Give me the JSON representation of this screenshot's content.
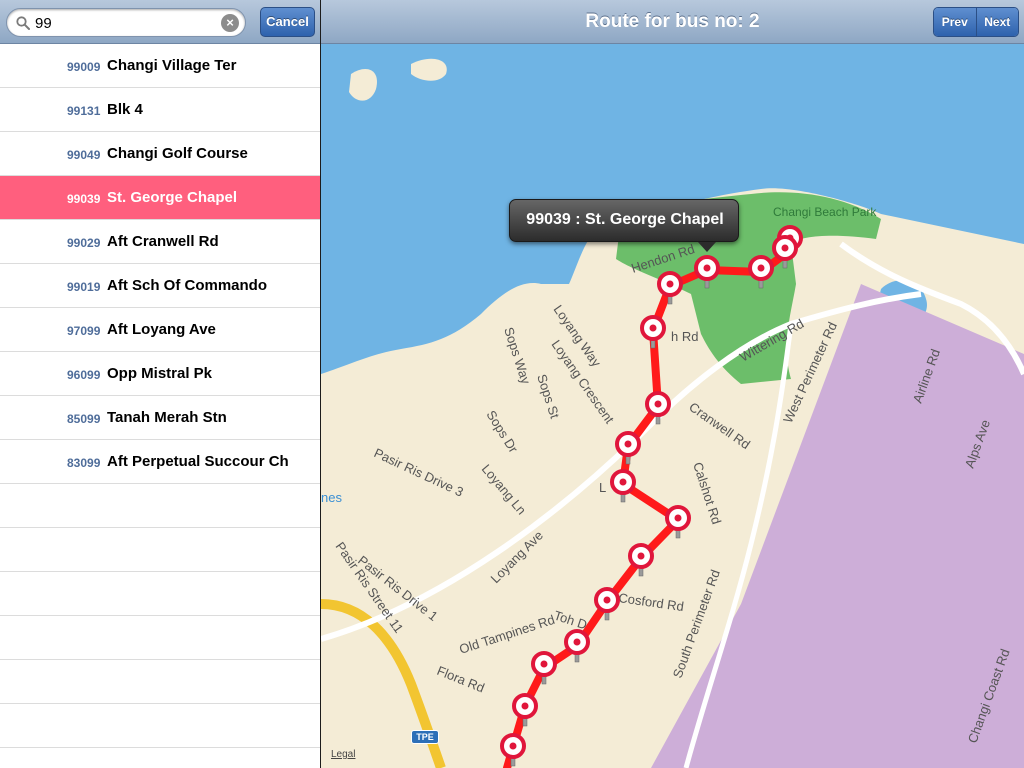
{
  "search": {
    "value": "99",
    "cancel_label": "Cancel"
  },
  "stops": [
    {
      "code": "99009",
      "name": "Changi Village Ter",
      "selected": false
    },
    {
      "code": "99131",
      "name": "Blk 4",
      "selected": false
    },
    {
      "code": "99049",
      "name": "Changi Golf Course",
      "selected": false
    },
    {
      "code": "99039",
      "name": "St. George Chapel",
      "selected": true
    },
    {
      "code": "99029",
      "name": "Aft Cranwell Rd",
      "selected": false
    },
    {
      "code": "99019",
      "name": "Aft Sch Of Commando",
      "selected": false
    },
    {
      "code": "97099",
      "name": "Aft Loyang Ave",
      "selected": false
    },
    {
      "code": "96099",
      "name": "Opp Mistral Pk",
      "selected": false
    },
    {
      "code": "85099",
      "name": "Tanah Merah Stn",
      "selected": false
    },
    {
      "code": "83099",
      "name": "Aft Perpetual Succour Ch",
      "selected": false
    }
  ],
  "nav": {
    "title": "Route for bus no: 2",
    "prev_label": "Prev",
    "next_label": "Next"
  },
  "map": {
    "callout": "99039 : St. George Chapel",
    "legal_label": "Legal",
    "highway_badge": "TPE",
    "labels": {
      "changi_beach_park": "Changi Beach Park",
      "hendon_rd": "Hendon Rd",
      "h_rd": "h Rd",
      "wittering_rd": "Wittering Rd",
      "west_perimeter_rd": "West Perimeter Rd",
      "airline_rd": "Airline Rd",
      "alps_ave": "Alps Ave",
      "loyang_way": "Loyang Way",
      "loyang_crescent": "Loyang Crescent",
      "sops_way": "Sops Way",
      "sops_st": "Sops St",
      "sops_dr": "Sops Dr",
      "cranwell_rd": "Cranwell Rd",
      "calshot_rd": "Calshot Rd",
      "pasir_ris_drive_3": "Pasir Ris Drive 3",
      "loyang_ln": "Loyang Ln",
      "loyang_ave": "Loyang Ave",
      "pasir_ris_street_11": "Pasir Ris Street 11",
      "pasir_ris_drive_1": "Pasir Ris Drive 1",
      "cosford_rd": "Cosford Rd",
      "toh_dr": "Toh Dr",
      "old_tampines_rd": "Old Tampines Rd",
      "flora_rd": "Flora Rd",
      "south_perimeter_rd": "South Perimeter Rd",
      "changi_coast_rd": "Changi Coast Rd",
      "l": "L",
      "nes": "nes"
    }
  },
  "colors": {
    "selected_row": "#ff5f7e",
    "route": "#ff1a1a",
    "water": "#6fb4e4",
    "land": "#f4ecd6",
    "park": "#6cbe6a",
    "airport": "#cdaed8"
  }
}
